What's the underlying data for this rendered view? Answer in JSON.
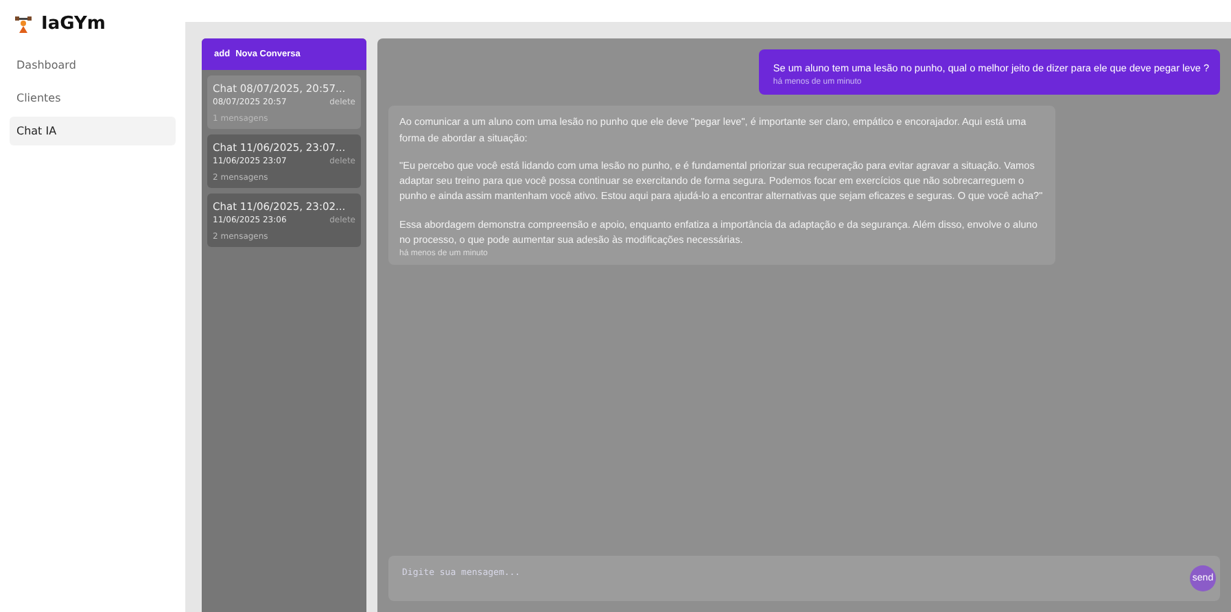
{
  "app": {
    "name": "IaGYm"
  },
  "nav": [
    {
      "label": "Dashboard",
      "selected": false
    },
    {
      "label": "Clientes",
      "selected": false
    },
    {
      "label": "Chat IA",
      "selected": true
    }
  ],
  "new_chat_button": {
    "icon": "add",
    "label": "Nova Conversa"
  },
  "chats": [
    {
      "title": "Chat 08/07/2025, 20:57...",
      "date": "08/07/2025 20:57",
      "delete": "delete",
      "count": "1 mensagens",
      "selected": true
    },
    {
      "title": "Chat 11/06/2025, 23:07...",
      "date": "11/06/2025 23:07",
      "delete": "delete",
      "count": "2 mensagens",
      "selected": false
    },
    {
      "title": "Chat 11/06/2025, 23:02...",
      "date": "11/06/2025 23:06",
      "delete": "delete",
      "count": "2 mensagens",
      "selected": false
    }
  ],
  "messages": [
    {
      "kind": "user",
      "paragraphs": [
        "Se um aluno tem uma lesão no punho, qual o melhor jeito de dizer para ele que deve pegar leve ?"
      ],
      "time": "há menos de um minuto"
    },
    {
      "kind": "assistant",
      "paragraphs": [
        "Ao comunicar a um aluno com uma lesão no punho que ele deve \"pegar leve\", é importante ser claro, empático e encorajador. Aqui está uma forma de abordar a situação:",
        "\"Eu percebo que você está lidando com uma lesão no punho, e é fundamental priorizar sua recuperação para evitar agravar a situação. Vamos adaptar seu treino para que você possa continuar se exercitando de forma segura. Podemos focar em exercícios que não sobrecarreguem o punho e ainda assim mantenham você ativo. Estou aqui para ajudá-lo a encontrar alternativas que sejam eficazes e seguras. O que você acha?\"",
        "Essa abordagem demonstra compreensão e apoio, enquanto enfatiza a importância da adaptação e da segurança. Além disso, envolve o aluno no processo, o que pode aumentar sua adesão às modificações necessárias."
      ],
      "time": "há menos de um minuto"
    }
  ],
  "composer": {
    "placeholder": "Digite sua mensagem...",
    "send": "send"
  }
}
